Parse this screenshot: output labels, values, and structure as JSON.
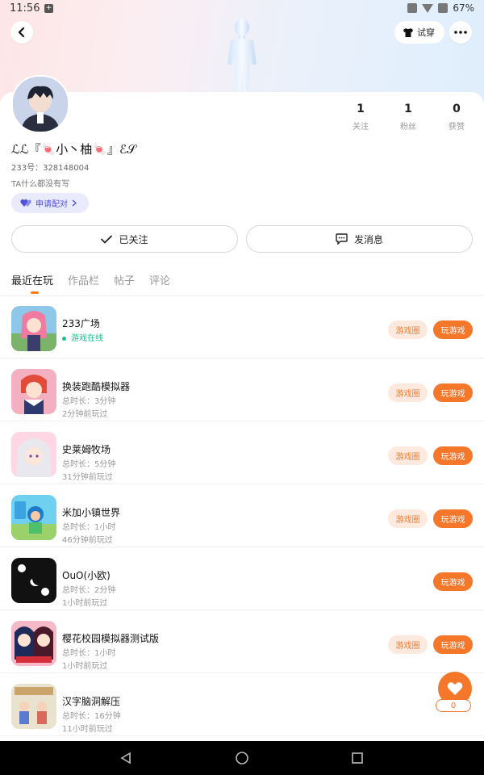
{
  "status": {
    "time": "11:56",
    "battery": "67%"
  },
  "header": {
    "tryon_label": "试穿"
  },
  "profile": {
    "stats": [
      {
        "num": "1",
        "label": "关注"
      },
      {
        "num": "1",
        "label": "粉丝"
      },
      {
        "num": "0",
        "label": "获赞"
      }
    ],
    "nickname": "ℒℒ『🍬小丶柚🍬』ℰ𝒮",
    "uid": "233号：328148004",
    "bio": "TA什么都没有写",
    "pair_label": "申请配对",
    "follow_label": "已关注",
    "message_label": "发消息"
  },
  "tabs": [
    {
      "label": "最近在玩"
    },
    {
      "label": "作品栏"
    },
    {
      "label": "帖子"
    },
    {
      "label": "评论"
    }
  ],
  "games": [
    {
      "name": "233广场",
      "sub1": "游戏在线",
      "sub2": "",
      "online": true,
      "has_circle": true
    },
    {
      "name": "换装跑酷模拟器",
      "sub1": "总时长：3分钟",
      "sub2": "2分钟前玩过",
      "online": false,
      "has_circle": true
    },
    {
      "name": "史莱姆牧场",
      "sub1": "总时长：5分钟",
      "sub2": "31分钟前玩过",
      "online": false,
      "has_circle": true
    },
    {
      "name": "米加小镇世界",
      "sub1": "总时长：1小时",
      "sub2": "46分钟前玩过",
      "online": false,
      "has_circle": true
    },
    {
      "name": "OuO(小欧)",
      "sub1": "总时长：2分钟",
      "sub2": "1小时前玩过",
      "online": false,
      "has_circle": false
    },
    {
      "name": "樱花校园模拟器测试版",
      "sub1": "总时长：1小时",
      "sub2": "1小时前玩过",
      "online": false,
      "has_circle": true
    },
    {
      "name": "汉字脑洞解压",
      "sub1": "总时长：16分钟",
      "sub2": "11小时前玩过",
      "online": false,
      "has_circle": false
    }
  ],
  "buttons": {
    "circle_label": "游戏圈",
    "play_label": "玩游戏"
  },
  "fab": {
    "count": "0"
  },
  "colors": {
    "accent": "#f5772a",
    "pair": "#4f52d4",
    "online": "#1bc08f"
  }
}
